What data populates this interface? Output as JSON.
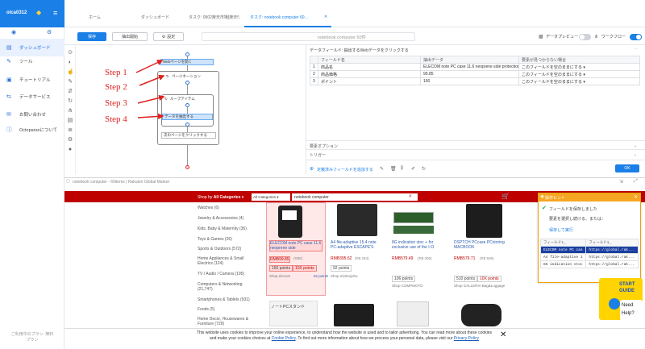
{
  "sidebar": {
    "user": "olca0312",
    "items": [
      {
        "icon": "dashboard-icon",
        "label": "ダッシュボード",
        "active": true
      },
      {
        "icon": "tool-icon",
        "label": "ツール"
      },
      {
        "icon": "tutorial-icon",
        "label": "チュートリアル"
      },
      {
        "icon": "data-service-icon",
        "label": "データサービス"
      },
      {
        "icon": "mail-icon",
        "label": "お問い合わせ"
      },
      {
        "icon": "info-icon",
        "label": "Octoparseについて"
      }
    ],
    "footer": "ご利用中のプラン: 無料プラン"
  },
  "tabs": [
    {
      "label": "ホーム",
      "active": false
    },
    {
      "label": "ダッシュボード",
      "active": false
    },
    {
      "label": "タスク: 0902楽天市場[楽天...",
      "active": false
    },
    {
      "label": "タスク: notebook computer 60…",
      "active": true
    }
  ],
  "toolbar": {
    "save": "保存",
    "start": "抽出開始",
    "settings": "設定",
    "url": "notebook computer 60件",
    "preview": "データプレビュー",
    "workflow": "ワークフロー"
  },
  "workflow": {
    "node_open": "Webページを開く",
    "loop_pagination": "ページネーション",
    "loop_items": "ループアイテム",
    "node_extract": "データを抽出する",
    "node_next": "次のページをクリックする",
    "steps": [
      "Step 1",
      "Step 2",
      "Step 3",
      "Step 4"
    ]
  },
  "datapanel": {
    "title": "データフィールド: 抽出するWebデータをクリックする",
    "headers": [
      "フィールド名",
      "抽出データ",
      "要素が見つからない場合"
    ],
    "rows": [
      {
        "no": "1",
        "name": "商品名",
        "value": "ELECOM note PC case 11.6 neoprene side protection...",
        "missing": "このフィールドを空のままにする"
      },
      {
        "no": "2",
        "name": "商品価格",
        "value": "99.85",
        "missing": "このフィールドを空のままにする"
      },
      {
        "no": "3",
        "name": "ポイント",
        "value": "150",
        "missing": "このフィールドを空のままにする"
      }
    ],
    "section_options": "要素オプション",
    "section_trigger": "トリガー",
    "add_field": "定義済みフィールドを追加する",
    "ok": "OK"
  },
  "browser": {
    "address": "notebook computer - 60items | Rakuten Global Market",
    "shop_by": "Shop by",
    "all_categories": "All Categories",
    "cat_select": "All Categories",
    "search_value": "notebook computer",
    "categories": [
      "Watches (6)",
      "Jewelry & Accessories (4)",
      "Kids, Baby & Maternity (36)",
      "Toys & Games (26)",
      "Sports & Outdoors (572)",
      "Home Appliances & Small Electrics (124)",
      "TV / Audio / Camera (195)",
      "Computers & Networking (21,747)",
      "Smartphones & Tablets (931)",
      "Foods (5)",
      "Home Decor, Housewares & Furniture (729)"
    ],
    "products": [
      {
        "title": "ELECOM note PC case 11.6 neoprene side",
        "price": "RMB99.85",
        "price_extra": "(R$5)",
        "points1": "150 points",
        "points2": "10X points",
        "points_extra": "points",
        "shop": "Shop elecom",
        "pts_small": "62 points"
      },
      {
        "title": "A4 file-adaptive 15.4 note PC-adaptive ESCAPE'S",
        "price": "RMB395.62",
        "price_extra": "(R$ 264)",
        "points1": "92 points",
        "shop": "Shop mintexjoho"
      },
      {
        "title": "8G indication stoc + for exclusive use of the I-O",
        "price": "RMB579.49",
        "price_extra": "(R$ 306)",
        "points1": "106 points",
        "shop": "Shop COMPMOTO"
      },
      {
        "title": "DSPTCH PCcase PCstoring MACBOOK",
        "price": "RMB579.71",
        "price_extra": "(R$ 505)",
        "points1": "510 points",
        "points2": "10X points",
        "shop": "Shop GALLERIA Bag&Luggage"
      }
    ],
    "lower_caption": "ノートPCスタンド"
  },
  "tips": {
    "title": "操作ヒント",
    "saved": "フィールドを保存しました",
    "select": "要素を選択し続ける、または：",
    "save_run": "保存して実行",
    "col1": "フィールド1_",
    "col2": "フィールド1_",
    "rows": [
      [
        "ELECOM note PC cas",
        "https://global.rak..."
      ],
      [
        "A4 file-adaptive 1",
        "https://global.rak..."
      ],
      [
        "8G indication stoc",
        "https://global.rak..."
      ]
    ]
  },
  "guide": {
    "line1": "START",
    "line2": "GUIDE",
    "need": "Need",
    "help": "Help?"
  },
  "cookie": {
    "text1": "This website uses cookies to improve your online experience, to understand how the website is used and to tailor advertising. You can read more about these",
    "text2": "cookies and make your cookies choices at",
    "link1": "Cookie Policy",
    "text3": ". To find out more information about how we process your personal data, please visit our",
    "link2": "Privacy Policy",
    "close": "✕"
  },
  "colors": {
    "accent": "#1a7fe6",
    "rakuten": "#bf0000",
    "tips": "#f5a623",
    "step": "#e02020"
  }
}
